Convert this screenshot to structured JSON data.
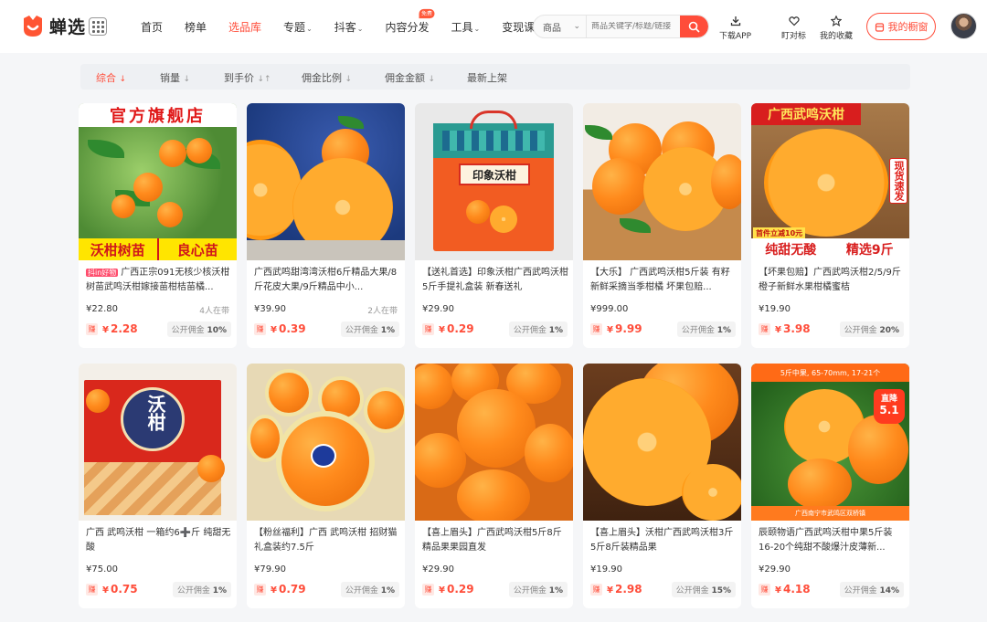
{
  "header": {
    "logo_text": "蝉选",
    "nav": [
      {
        "label": "首页",
        "active": false,
        "dropdown": false
      },
      {
        "label": "榜单",
        "active": false,
        "dropdown": false
      },
      {
        "label": "选品库",
        "active": true,
        "dropdown": false
      },
      {
        "label": "专题",
        "active": false,
        "dropdown": true
      },
      {
        "label": "抖客",
        "active": false,
        "dropdown": true
      },
      {
        "label": "内容分发",
        "active": false,
        "dropdown": false,
        "badge": "免费"
      },
      {
        "label": "工具",
        "active": false,
        "dropdown": true
      },
      {
        "label": "变现课堂",
        "active": false,
        "dropdown": false
      }
    ],
    "search": {
      "type_label": "商品",
      "placeholder": "商品关键字/标题/链接"
    },
    "tools": {
      "download": "下载APP",
      "favorite_mark": "盯对标",
      "my_collection": "我的收藏"
    },
    "my_window": "我的橱窗"
  },
  "sortbar": [
    {
      "label": "综合",
      "arrow": "↓",
      "active": true
    },
    {
      "label": "销量",
      "arrow": "↓",
      "active": false
    },
    {
      "label": "到手价",
      "arrow": "↓↑",
      "active": false
    },
    {
      "label": "佣金比例",
      "arrow": "↓",
      "active": false
    },
    {
      "label": "佣金金额",
      "arrow": "↓",
      "active": false
    },
    {
      "label": "最新上架",
      "arrow": "",
      "active": false
    }
  ],
  "products": [
    {
      "tag": "抖in好物",
      "title": "广西正宗091无核少核沃柑树苗武鸣沃柑嫁接苗柑桔苗橘...",
      "price": "¥22.80",
      "sold": "4人在带",
      "commission": "2.28",
      "rate_label": "公开佣金",
      "rate": "10%",
      "img_top": "官方旗舰店",
      "img_bottom_left": "沃柑树苗",
      "img_bottom_right": "良心苗"
    },
    {
      "tag": "",
      "title": "广西武鸣甜湾湾沃柑6斤精品大果/8斤花皮大果/9斤精品中小...",
      "price": "¥39.90",
      "sold": "2人在带",
      "commission": "0.39",
      "rate_label": "公开佣金",
      "rate": "1%"
    },
    {
      "tag": "",
      "title": "【送礼首选】印象沃柑广西武鸣沃柑 5斤手提礼盒装 新春送礼",
      "price": "¥29.90",
      "sold": "",
      "commission": "0.29",
      "rate_label": "公开佣金",
      "rate": "1%",
      "img_box_label": "印象沃柑"
    },
    {
      "tag": "",
      "title": "【大乐】 广西武鸣沃柑5斤装 有籽新鲜采摘当季柑橘 坏果包赔...",
      "price": "¥999.00",
      "sold": "",
      "commission": "9.99",
      "rate_label": "公开佣金",
      "rate": "1%"
    },
    {
      "tag": "",
      "title": "【坏果包赔】广西武鸣沃柑2/5/9斤橙子新鲜水果柑橘蜜桔",
      "price": "¥19.90",
      "sold": "",
      "commission": "3.98",
      "rate_label": "公开佣金",
      "rate": "20%",
      "img_top": "广西武鸣沃柑",
      "img_side": "现货速发",
      "img_small": "首件立减10元",
      "img_bottom_left": "纯甜无酸",
      "img_bottom_right": "精选9斤"
    },
    {
      "tag": "",
      "title": "广西 武鸣沃柑 一箱约6➕斤 纯甜无酸",
      "price": "¥75.00",
      "sold": "",
      "commission": "0.75",
      "rate_label": "公开佣金",
      "rate": "1%",
      "img_box_label": "沃柑"
    },
    {
      "tag": "",
      "title": "【粉丝福利】广西 武鸣沃柑 招财猫礼盒装约7.5斤",
      "price": "¥79.90",
      "sold": "",
      "commission": "0.79",
      "rate_label": "公开佣金",
      "rate": "1%"
    },
    {
      "tag": "",
      "title": "【喜上眉头】广西武鸣沃柑5斤8斤精品果果园直发",
      "price": "¥29.90",
      "sold": "",
      "commission": "0.29",
      "rate_label": "公开佣金",
      "rate": "1%"
    },
    {
      "tag": "",
      "title": "【喜上眉头】沃柑广西武鸣沃柑3斤5斤8斤装精品果",
      "price": "¥19.90",
      "sold": "",
      "commission": "2.98",
      "rate_label": "公开佣金",
      "rate": "15%"
    },
    {
      "tag": "",
      "title": "辰颐物语广西武鸣沃柑中果5斤装16-20个纯甜不酸爆汁皮薄新...",
      "price": "¥29.90",
      "sold": "",
      "commission": "4.18",
      "rate_label": "公开佣金",
      "rate": "14%",
      "img_top": "5斤中果, 65-70mm, 17-21个",
      "img_badge": "直降",
      "img_badge_value": "5.1",
      "img_bottom": "广西南宁市武鸣区双桥镇"
    }
  ],
  "commission_icon": "赚",
  "commission_prefix": "¥"
}
